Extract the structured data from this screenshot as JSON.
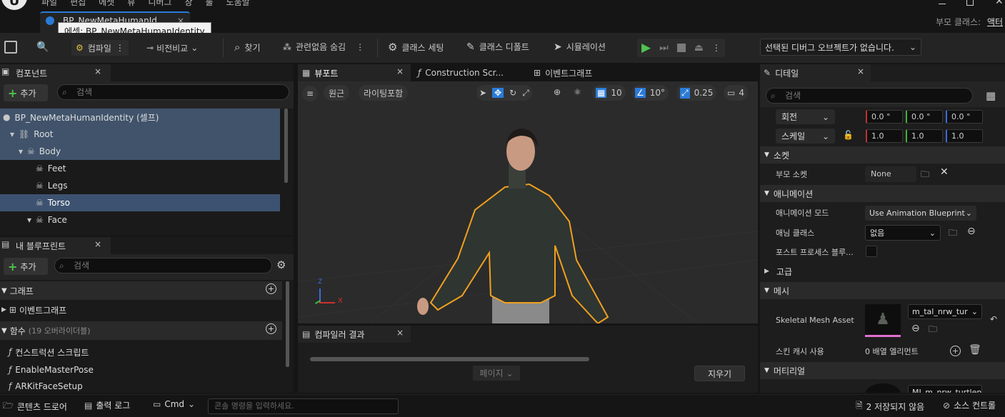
{
  "menu": {
    "items": [
      "파일",
      "편집",
      "에셋",
      "뷰",
      "디버그",
      "창",
      "툴",
      "도움말"
    ]
  },
  "asset_tab": {
    "label": "BP_NewMetaHumanId...",
    "tooltip": "에셋: BP_NewMetaHumanIdentity"
  },
  "parent_class": {
    "label": "부모 클래스:",
    "value": "액터"
  },
  "toolbar": {
    "compile": "컴파일",
    "diff": "비전비교",
    "find": "찾기",
    "hide_unrelated": "관련없음 숨김",
    "class_settings": "클래스 세팅",
    "class_defaults": "클래스 디폴트",
    "simulation": "시뮬레이션",
    "debug_object": "선택된 디버그 오브젝트가 없습니다."
  },
  "components": {
    "title": "컴포넌트",
    "add": "추가",
    "search_placeholder": "검색",
    "tree": [
      {
        "label": "BP_NewMetaHumanIdentity (셀프)"
      },
      {
        "label": "Root"
      },
      {
        "label": "Body"
      },
      {
        "label": "Feet"
      },
      {
        "label": "Legs"
      },
      {
        "label": "Torso"
      },
      {
        "label": "Face"
      }
    ]
  },
  "my_blueprint": {
    "title": "내 블루프린트",
    "add": "추가",
    "search_placeholder": "검색",
    "graphs": "그래프",
    "event_graph": "이벤트그래프",
    "functions": "함수",
    "functions_count": "(19 오버라이더블)",
    "items": [
      "컨스트럭션 스크립트",
      "EnableMasterPose",
      "ARKitFaceSetup"
    ]
  },
  "viewport": {
    "tabs": [
      "뷰포트",
      "Construction Scr...",
      "이벤트그래프"
    ],
    "perspective": "원근",
    "lighting": "라이팅포함",
    "grid": "10",
    "angle": "10°",
    "scale": "0.25",
    "cam_speed": "4",
    "axis_x": "X",
    "axis_z": "Z"
  },
  "compiler": {
    "title": "컴파일러 결과",
    "page": "페이지",
    "clear": "지우기"
  },
  "details": {
    "title": "디테일",
    "search_placeholder": "검색",
    "rotation": {
      "label": "회전",
      "x": "0.0 °",
      "y": "0.0 °",
      "z": "0.0 °"
    },
    "scale": {
      "label": "스케일",
      "x": "1.0",
      "y": "1.0",
      "z": "1.0"
    },
    "socket_section": "소켓",
    "parent_socket": "부모 소켓",
    "parent_socket_value": "None",
    "animation_section": "애니메이션",
    "anim_mode_label": "애니메이션 모드",
    "anim_mode_value": "Use Animation Blueprint",
    "anim_class_label": "애님 클래스",
    "anim_class_value": "없음",
    "post_process_label": "포스트 프로세스 블루...",
    "advanced": "고급",
    "mesh_section": "메시",
    "skeletal_mesh_label": "Skeletal Mesh Asset",
    "skeletal_mesh_value": "m_tal_nrw_tur",
    "skin_cache_label": "스킨 캐시 사용",
    "skin_cache_value": "0 배열 엘리먼트",
    "material_section": "머티리얼",
    "material_value": "MI_m_nrw_turtlenec"
  },
  "statusbar": {
    "content_drawer": "콘텐츠 드로어",
    "output_log": "출력 로그",
    "cmd": "Cmd",
    "console_placeholder": "콘솔 명령을 입력하세요.",
    "unsaved": "2 저장되지 않음",
    "source_control": "소스 컨트롤"
  },
  "colors": {
    "accent_blue": "#2a7bd8",
    "play_green": "#4ec34e",
    "selection": "#40536b",
    "outline_orange": "#f0a020"
  }
}
